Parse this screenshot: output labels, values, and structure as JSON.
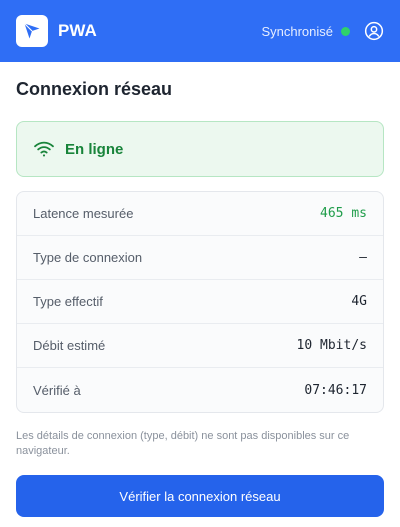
{
  "header": {
    "app_name": "PWA",
    "sync_status": "Synchronisé"
  },
  "main": {
    "title": "Connexion réseau",
    "status": "En ligne",
    "rows": [
      {
        "label": "Latence mesurée",
        "value": "465 ms"
      },
      {
        "label": "Type de connexion",
        "value": "—"
      },
      {
        "label": "Type effectif",
        "value": "4G"
      },
      {
        "label": "Débit estimé",
        "value": "10 Mbit/s"
      },
      {
        "label": "Vérifié à",
        "value": "07:46:17"
      }
    ],
    "note": "Les détails de connexion (type, débit) ne sont pas disponibles sur ce navigateur.",
    "check_button": "Vérifier la connexion réseau"
  },
  "colors": {
    "header_bg": "#2f6ef5",
    "success": "#1f9d4a",
    "button": "#2563eb"
  }
}
